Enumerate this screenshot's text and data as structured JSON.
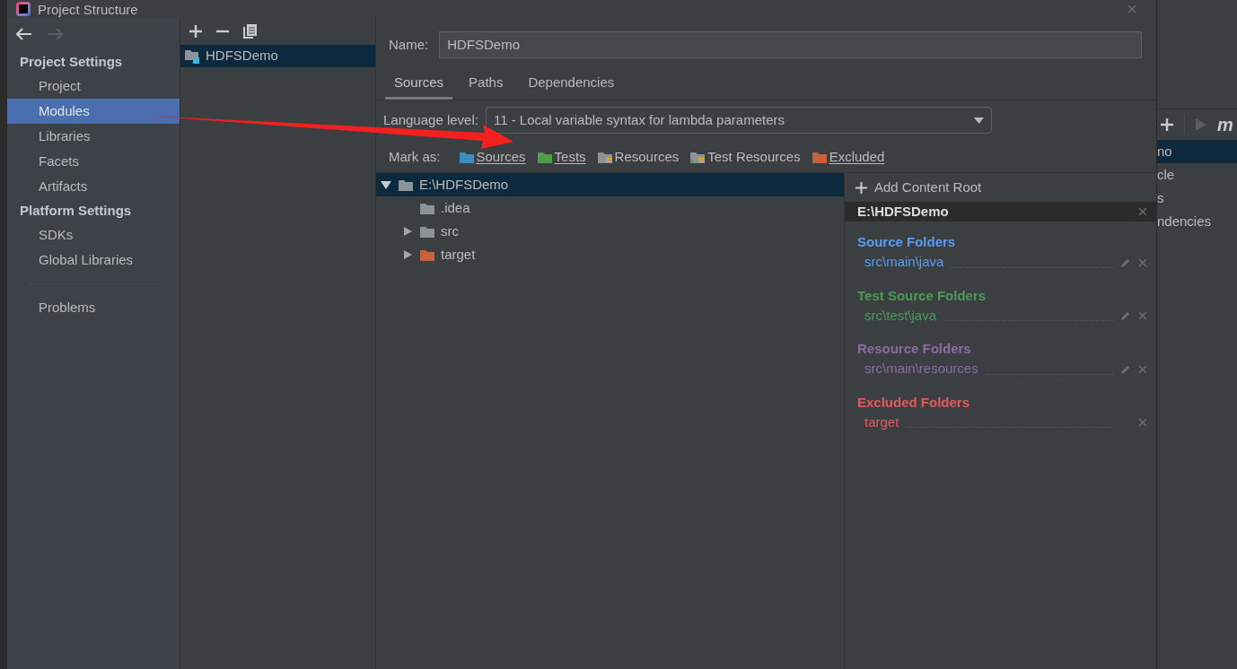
{
  "dialog": {
    "title": "Project Structure"
  },
  "nav": {
    "sections": [
      {
        "heading": "Project Settings",
        "items": [
          {
            "label": "Project",
            "selected": false
          },
          {
            "label": "Modules",
            "selected": true
          },
          {
            "label": "Libraries",
            "selected": false
          },
          {
            "label": "Facets",
            "selected": false
          },
          {
            "label": "Artifacts",
            "selected": false
          }
        ]
      },
      {
        "heading": "Platform Settings",
        "items": [
          {
            "label": "SDKs",
            "selected": false
          },
          {
            "label": "Global Libraries",
            "selected": false
          }
        ]
      }
    ],
    "footer_items": [
      {
        "label": "Problems",
        "selected": false
      }
    ]
  },
  "modules": [
    {
      "name": "HDFSDemo",
      "selected": true
    }
  ],
  "name_field": {
    "label": "Name:",
    "value": "HDFSDemo"
  },
  "tabs": [
    {
      "label": "Sources",
      "selected": true
    },
    {
      "label": "Paths",
      "selected": false
    },
    {
      "label": "Dependencies",
      "selected": false
    }
  ],
  "language_level": {
    "label": "Language level:",
    "value": "11 - Local variable syntax for lambda parameters"
  },
  "mark_as": {
    "label": "Mark as:",
    "options": [
      {
        "label": "Sources",
        "color": "#3f8dbf",
        "kind": "plain",
        "underlined": true
      },
      {
        "label": "Tests",
        "color": "#529c4c",
        "kind": "plain",
        "underlined": true
      },
      {
        "label": "Resources",
        "color": "#8c9399",
        "kind": "resources",
        "underlined": false
      },
      {
        "label": "Test Resources",
        "color": "#8c9399",
        "kind": "test-resources",
        "underlined": false
      },
      {
        "label": "Excluded",
        "color": "#c7623a",
        "kind": "plain",
        "underlined": true
      }
    ]
  },
  "tree": [
    {
      "label": "E:\\HDFSDemo",
      "color": "#8c9399",
      "expanded": true,
      "selected": true,
      "children": [
        {
          "label": ".idea",
          "color": "#8c9399",
          "selected": false
        },
        {
          "label": "src",
          "color": "#8c9399",
          "expanded": false,
          "selected": false
        },
        {
          "label": "target",
          "color": "#c7623a",
          "expanded": false,
          "selected": false
        }
      ]
    }
  ],
  "content_root": {
    "add_button": "Add Content Root",
    "root": "E:\\HDFSDemo",
    "groups": [
      {
        "heading": "Source Folders",
        "color": "#589df6",
        "folders": [
          {
            "path": "src\\main\\java",
            "editable": true
          }
        ]
      },
      {
        "heading": "Test Source Folders",
        "color": "#499c54",
        "folders": [
          {
            "path": "src\\test\\java",
            "editable": true
          }
        ]
      },
      {
        "heading": "Resource Folders",
        "color": "#8b6aa6",
        "folders": [
          {
            "path": "src\\main\\resources",
            "editable": true
          }
        ]
      },
      {
        "heading": "Excluded Folders",
        "color": "#e5585e",
        "folders": [
          {
            "path": "target",
            "editable": false
          }
        ]
      }
    ]
  },
  "background_window": {
    "toolbar_text": "m",
    "items": [
      {
        "label": "no",
        "selected": true
      },
      {
        "label": "cle",
        "selected": false
      },
      {
        "label": "s",
        "selected": false
      },
      {
        "label": "ndencies",
        "selected": false
      }
    ]
  }
}
